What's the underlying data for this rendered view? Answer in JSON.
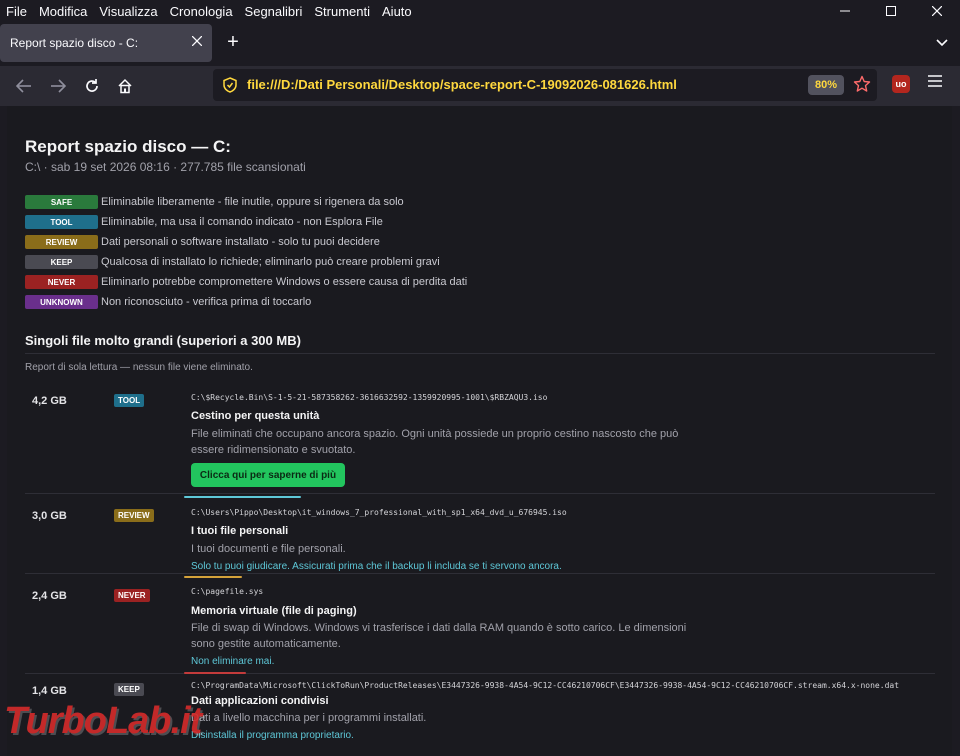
{
  "menubar": {
    "items": [
      "File",
      "Modifica",
      "Visualizza",
      "Cronologia",
      "Segnalibri",
      "Strumenti",
      "Aiuto"
    ]
  },
  "window_controls": {
    "minimize": "—",
    "maximize": "☐",
    "close": "✕"
  },
  "tab": {
    "title": "Report spazio disco - C:",
    "close": "✕",
    "new_tab": "+"
  },
  "navbar": {
    "url": "file:///D:/Dati Personali/Desktop/space-report-C-19092026-081626.html",
    "zoom": "80%",
    "ublock_label": "uo"
  },
  "page": {
    "title": "Report spazio disco — C:",
    "subtitle": "C:\\ · sab 19 set 2026 08:16 · 277.785 file scansionati",
    "legend": [
      {
        "badge": "SAFE",
        "color": "#2a7a3c",
        "text": "Eliminabile liberamente - file inutile, oppure si rigenera da solo"
      },
      {
        "badge": "TOOL",
        "color": "#1f6f8b",
        "text": "Eliminabile, ma usa il comando indicato - non Esplora File"
      },
      {
        "badge": "REVIEW",
        "color": "#8a6d1a",
        "text": "Dati personali o software installato - solo tu puoi decidere"
      },
      {
        "badge": "KEEP",
        "color": "#4a4a52",
        "text": "Qualcosa di installato lo richiede; eliminarlo può creare problemi gravi"
      },
      {
        "badge": "NEVER",
        "color": "#9b2222",
        "text": "Eliminarlo potrebbe compromettere Windows o essere causa di perdita dati"
      },
      {
        "badge": "UNKNOWN",
        "color": "#6a2f8c",
        "text": "Non riconosciuto - verifica prima di toccarlo"
      }
    ],
    "section_title": "Singoli file molto grandi (superiori a 300 MB)",
    "section_note": "Report di sola lettura — nessun file viene eliminato.",
    "entries": [
      {
        "size": "4,2 GB",
        "tag": "TOOL",
        "tag_color": "#1f6f8b",
        "path": "C:\\$Recycle.Bin\\S-1-5-21-587358262-3616632592-1359920995-1001\\$RBZAQU3.iso",
        "title": "Cestino per questa unità",
        "desc": "File eliminati che occupano ancora spazio. Ogni unità possiede un proprio cestino nascosto che può essere ridimensionato e svuotato.",
        "cta": "Clicca qui per saperne di più"
      },
      {
        "size": "3,0 GB",
        "tag": "REVIEW",
        "tag_color": "#8a6d1a",
        "path": "C:\\Users\\Pippo\\Desktop\\it_windows_7_professional_with_sp1_x64_dvd_u_676945.iso",
        "title": "I tuoi file personali",
        "desc": "I tuoi documenti e file personali.",
        "advice": "Solo tu puoi giudicare. Assicurati prima che il backup li includa se ti servono ancora."
      },
      {
        "size": "2,4 GB",
        "tag": "NEVER",
        "tag_color": "#9b2222",
        "path": "C:\\pagefile.sys",
        "title": "Memoria virtuale (file di paging)",
        "desc": "File di swap di Windows. Windows vi trasferisce i dati dalla RAM quando è sotto carico. Le dimensioni sono gestite automaticamente.",
        "advice": "Non eliminare mai."
      },
      {
        "size": "1,4 GB",
        "tag": "KEEP",
        "tag_color": "#4a4a52",
        "path": "C:\\ProgramData\\Microsoft\\ClickToRun\\ProductReleases\\E3447326-9938-4A54-9C12-CC46210706CF\\E3447326-9938-4A54-9C12-CC46210706CF.stream.x64.x-none.dat",
        "title": "Dati applicazioni condivisi",
        "desc": "Dati a livello macchina per i programmi installati.",
        "advice": "Disinstalla il programma proprietario."
      }
    ]
  },
  "watermark": "TurboLab.it",
  "colors": {
    "accent_url": "#ffd83e",
    "cta": "#22c55e",
    "advice": "#5ec8d8"
  }
}
